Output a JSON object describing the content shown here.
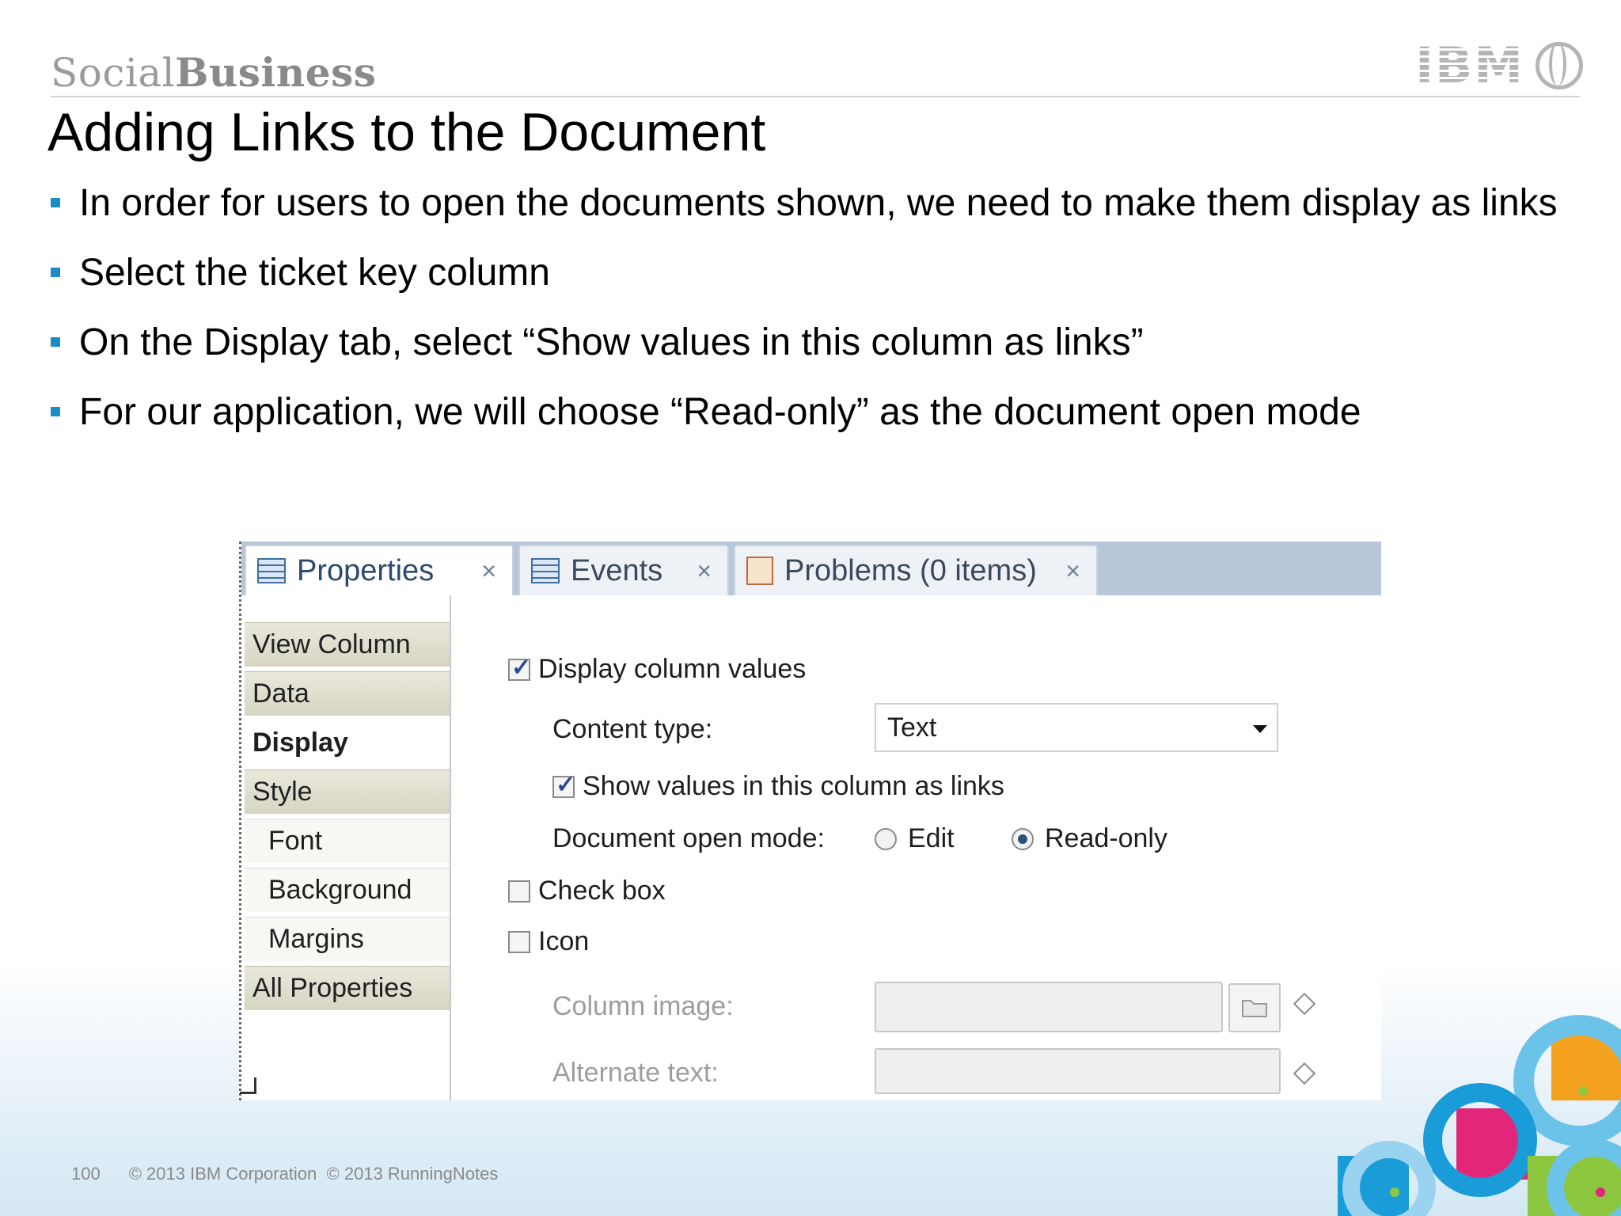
{
  "header": {
    "brand_light": "Social",
    "brand_bold": "Business",
    "logo_text": "IBM"
  },
  "slide": {
    "title": "Adding Links to the Document",
    "bullets": [
      "In order for users to open the documents shown, we need to make them display as links",
      "Select the ticket key column",
      "On the Display tab, select “Show values in this column as links”",
      "For our application, we will choose “Read-only” as the document open mode"
    ]
  },
  "panel": {
    "tabs": [
      {
        "label": "Properties",
        "active": true,
        "icon": "properties-icon"
      },
      {
        "label": "Events",
        "active": false,
        "icon": "events-icon"
      },
      {
        "label": "Problems (0 items)",
        "active": false,
        "icon": "problems-icon"
      }
    ],
    "close_glyph": "×",
    "sidebar": [
      {
        "label": "View Column",
        "type": "section"
      },
      {
        "label": "Data",
        "type": "section"
      },
      {
        "label": "Display",
        "type": "selected"
      },
      {
        "label": "Style",
        "type": "section"
      },
      {
        "label": "Font",
        "type": "sub"
      },
      {
        "label": "Background",
        "type": "sub"
      },
      {
        "label": "Margins",
        "type": "sub"
      },
      {
        "label": "All Properties",
        "type": "section"
      }
    ],
    "display": {
      "display_values_label": "Display column values",
      "display_values_checked": true,
      "content_type_label": "Content type:",
      "content_type_value": "Text",
      "show_links_label": "Show values in this column as links",
      "show_links_checked": true,
      "open_mode_label": "Document open mode:",
      "open_mode_edit": "Edit",
      "open_mode_readonly": "Read-only",
      "open_mode_selected": "Read-only",
      "checkbox_label": "Check box",
      "checkbox_checked": false,
      "icon_label": "Icon",
      "icon_checked": false,
      "column_image_label": "Column image:",
      "alternate_text_label": "Alternate text:"
    }
  },
  "footer": {
    "page_number": "100",
    "copyright_ibm": "© 2013 IBM Corporation",
    "copyright_rn": "© 2013 RunningNotes"
  },
  "colors": {
    "bullet": "#1a8cc7",
    "tabbar": "#b7c7d8",
    "deco_blue": "#1a9cd8",
    "deco_orange": "#f4a11f",
    "deco_pink": "#e2277a",
    "deco_green": "#8dc63f"
  }
}
